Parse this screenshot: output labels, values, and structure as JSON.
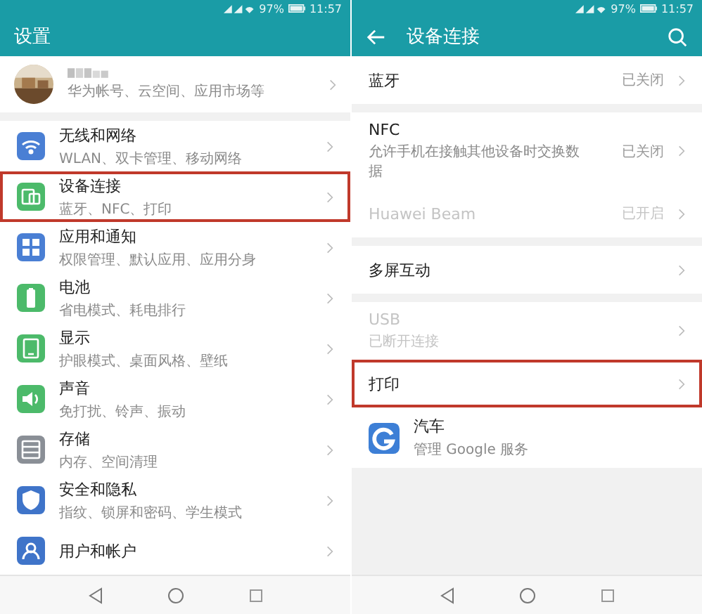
{
  "left_screen": {
    "status_bar": {
      "battery": "97%",
      "time": "11:57"
    },
    "title": "设置",
    "account": {
      "subtitle": "华为帐号、云空间、应用市场等"
    },
    "items": [
      {
        "title": "无线和网络",
        "subtitle": "WLAN、双卡管理、移动网络",
        "highlighted": false
      },
      {
        "title": "设备连接",
        "subtitle": "蓝牙、NFC、打印",
        "highlighted": true
      },
      {
        "title": "应用和通知",
        "subtitle": "权限管理、默认应用、应用分身",
        "highlighted": false
      },
      {
        "title": "电池",
        "subtitle": "省电模式、耗电排行",
        "highlighted": false
      },
      {
        "title": "显示",
        "subtitle": "护眼模式、桌面风格、壁纸",
        "highlighted": false
      },
      {
        "title": "声音",
        "subtitle": "免打扰、铃声、振动",
        "highlighted": false
      },
      {
        "title": "存储",
        "subtitle": "内存、空间清理",
        "highlighted": false
      },
      {
        "title": "安全和隐私",
        "subtitle": "指纹、锁屏和密码、学生模式",
        "highlighted": false
      },
      {
        "title": "用户和帐户",
        "highlighted": false
      }
    ]
  },
  "right_screen": {
    "status_bar": {
      "battery": "97%",
      "time": "11:57"
    },
    "title": "设备连接",
    "groups": [
      [
        {
          "kind": "setting",
          "title": "蓝牙",
          "value": "已关闭",
          "disabled": false,
          "highlighted": false
        }
      ],
      [
        {
          "kind": "setting",
          "title": "NFC",
          "subtitle": "允许手机在接触其他设备时交换数据",
          "value": "已关闭",
          "disabled": false,
          "highlighted": false
        },
        {
          "kind": "setting",
          "title": "Huawei Beam",
          "value": "已开启",
          "disabled": true,
          "highlighted": false
        }
      ],
      [
        {
          "kind": "setting",
          "title": "多屏互动",
          "disabled": false,
          "highlighted": false
        }
      ],
      [
        {
          "kind": "setting",
          "title": "USB",
          "subtitle": "已断开连接",
          "disabled": true,
          "highlighted": false
        },
        {
          "kind": "setting",
          "title": "打印",
          "disabled": false,
          "highlighted": true
        },
        {
          "kind": "app",
          "title": "汽车",
          "subtitle": "管理 Google 服务",
          "disabled": false,
          "highlighted": false
        }
      ]
    ]
  }
}
